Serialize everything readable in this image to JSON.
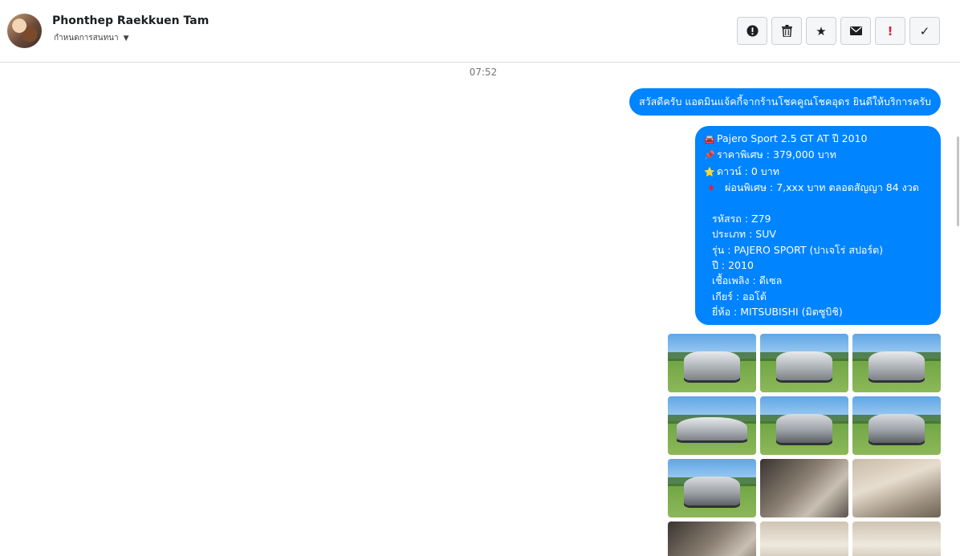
{
  "header": {
    "contact_name": "Phonthep Raekkuen Tam",
    "assign_label": "กำหนดการสนทนา",
    "actions": [
      {
        "icon": "exclamation-circle-icon",
        "glyph": "!"
      },
      {
        "icon": "trash-icon",
        "glyph": ""
      },
      {
        "icon": "star-icon",
        "glyph": "★"
      },
      {
        "icon": "envelope-icon",
        "glyph": ""
      },
      {
        "icon": "exclamation-icon",
        "glyph": "!"
      },
      {
        "icon": "check-icon",
        "glyph": "✓"
      }
    ]
  },
  "thread": {
    "timestamp": "07:52",
    "message1": "สวัสดีครับ แอดมินแจ้คกี้จากร้านโชคคูณโชคอุดร ยินดีให้บริการครับ",
    "message2": {
      "title": "Pajero Sport 2.5 GT AT ปี 2010",
      "price": "ราคาพิเศษ : 379,000 บาท",
      "down": "ดาวน์ : 0 บาท",
      "installment": "ผ่อนพิเศษ : 7,xxx บาท ตลอดสัญญา 84 งวด",
      "code": "รหัสรถ : Z79",
      "type": "ประเภท : SUV",
      "model": "รุ่น : PAJERO SPORT (ปาเจโร่ สปอร์ต)",
      "year": "ปี : 2010",
      "fuel": "เชื้อเพลิง : ดีเซล",
      "gear": "เกียร์ : ออโต้",
      "brand": "ยี่ห้อ : MITSUBISHI (มิตซูบิชิ)"
    },
    "emojis": {
      "car": "🚘",
      "pin": "📌",
      "star": "⭐",
      "diamond": "♦"
    },
    "photos": [
      {
        "kind": "exterior-front"
      },
      {
        "kind": "exterior-front"
      },
      {
        "kind": "exterior-front"
      },
      {
        "kind": "exterior-side"
      },
      {
        "kind": "exterior-rear"
      },
      {
        "kind": "exterior-rear"
      },
      {
        "kind": "exterior-rear"
      },
      {
        "kind": "interior-dashboard"
      },
      {
        "kind": "interior-door"
      },
      {
        "kind": "interior-dashboard"
      },
      {
        "kind": "interior-seats"
      },
      {
        "kind": "interior-seats"
      }
    ]
  },
  "colors": {
    "bubble": "#0084ff",
    "accent_red": "#e41e3f",
    "border": "#dadde1"
  }
}
